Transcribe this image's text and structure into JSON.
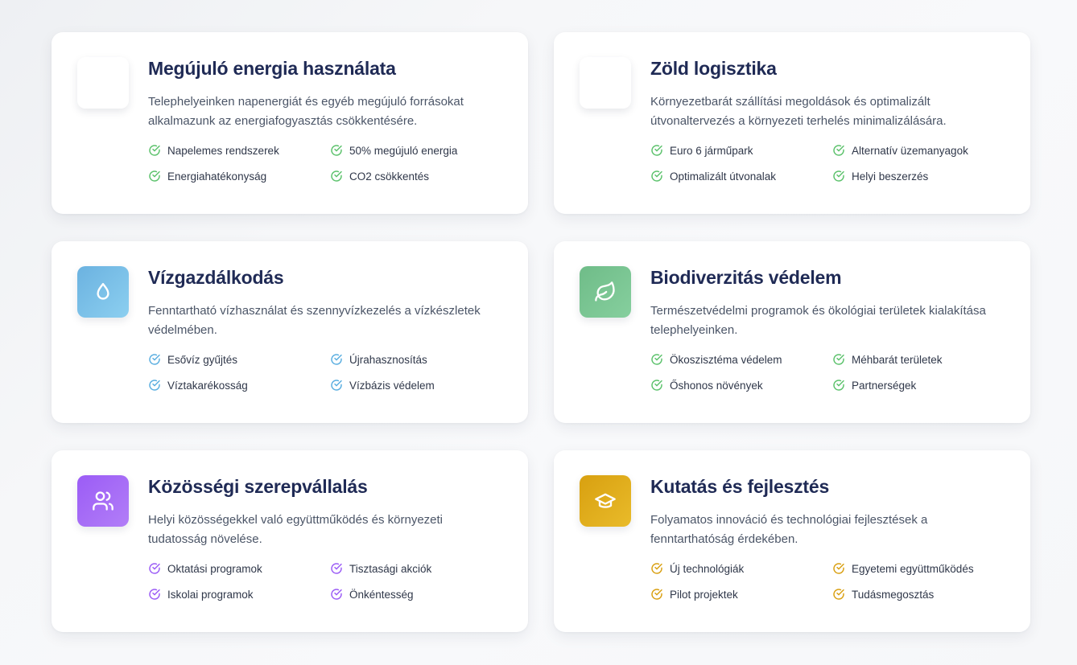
{
  "colors": {
    "green": "#5cc26c",
    "blue": "#5aaee0",
    "purple": "#9b5cf6",
    "gold": "#d9a012"
  },
  "cards": [
    {
      "title": "Megújuló energia használata",
      "description": "Telephelyeinken napenergiát és egyéb megújuló forrásokat alkalmazunk az energiafogyasztás csökkentésére.",
      "icon": "blank-icon",
      "features": [
        "Napelemes rendszerek",
        "50% megújuló energia",
        "Energiahatékonyság",
        "CO2 csökkentés"
      ]
    },
    {
      "title": "Zöld logisztika",
      "description": "Környezetbarát szállítási megoldások és optimalizált útvonaltervezés a környezeti terhelés minimalizálására.",
      "icon": "blank-icon",
      "features": [
        "Euro 6 járműpark",
        "Alternatív üzemanyagok",
        "Optimalizált útvonalak",
        "Helyi beszerzés"
      ]
    },
    {
      "title": "Vízgazdálkodás",
      "description": "Fenntartható vízhasználat és szennyvízkezelés a vízkészletek védelmében.",
      "icon": "water-drop-icon",
      "features": [
        "Esővíz gyűjtés",
        "Újrahasznosítás",
        "Víztakarékosság",
        "Vízbázis védelem"
      ]
    },
    {
      "title": "Biodiverzitás védelem",
      "description": "Természetvédelmi programok és ökológiai területek kialakítása telephelyeinken.",
      "icon": "leaf-icon",
      "features": [
        "Ökoszisztéma védelem",
        "Méhbarát területek",
        "Őshonos növények",
        "Partnerségek"
      ]
    },
    {
      "title": "Közösségi szerepvállalás",
      "description": "Helyi közösségekkel való együttműködés és környezeti tudatosság növelése.",
      "icon": "users-icon",
      "features": [
        "Oktatási programok",
        "Tisztasági akciók",
        "Iskolai programok",
        "Önkéntesség"
      ]
    },
    {
      "title": "Kutatás és fejlesztés",
      "description": "Folyamatos innováció és technológiai fejlesztések a fenntarthatóság érdekében.",
      "icon": "graduation-cap-icon",
      "features": [
        "Új technológiák",
        "Egyetemi együttműködés",
        "Pilot projektek",
        "Tudásmegosztás"
      ]
    }
  ]
}
